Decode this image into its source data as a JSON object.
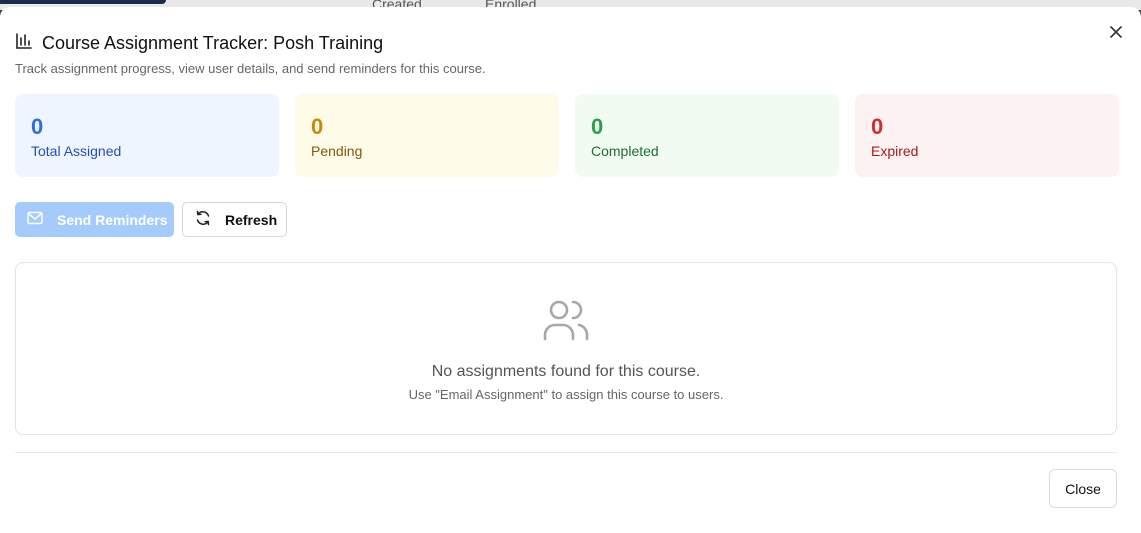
{
  "background": {
    "tabs": [
      "Created",
      "Enrolled"
    ]
  },
  "dialog": {
    "title": "Course Assignment Tracker: Posh Training",
    "subtitle": "Track assignment progress, view user details, and send reminders for this course.",
    "title_icon": "bar-chart-icon",
    "close_icon": "close-icon"
  },
  "stats": [
    {
      "value": "0",
      "label": "Total Assigned",
      "color": "#2f6fe0"
    },
    {
      "value": "0",
      "label": "Pending",
      "color": "#c98a0b"
    },
    {
      "value": "0",
      "label": "Completed",
      "color": "#2e9e4a"
    },
    {
      "value": "0",
      "label": "Expired",
      "color": "#d42b2b"
    }
  ],
  "actions": {
    "send_reminders_label": "Send Reminders",
    "send_reminders_icon": "mail-icon",
    "refresh_label": "Refresh",
    "refresh_icon": "refresh-icon"
  },
  "empty_state": {
    "icon": "users-icon",
    "title": "No assignments found for this course.",
    "subtitle": "Use \"Email Assignment\" to assign this course to users."
  },
  "footer": {
    "close_label": "Close"
  }
}
